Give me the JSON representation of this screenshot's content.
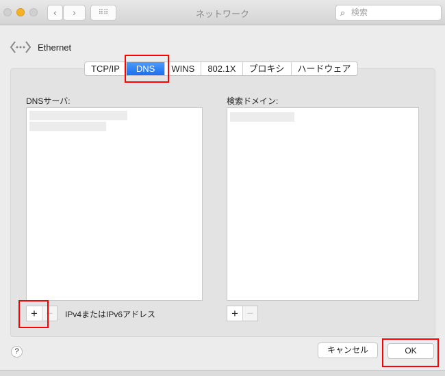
{
  "window": {
    "title": "ネットワーク",
    "search_placeholder": "検索"
  },
  "interface": {
    "name": "Ethernet",
    "icon": "ethernet-icon"
  },
  "tabs": [
    {
      "label": "TCP/IP"
    },
    {
      "label": "DNS",
      "active": true
    },
    {
      "label": "WINS"
    },
    {
      "label": "802.1X"
    },
    {
      "label": "プロキシ"
    },
    {
      "label": "ハードウェア"
    }
  ],
  "dns": {
    "label": "DNSサーバ:",
    "hint": "IPv4またはIPv6アドレス"
  },
  "search_domains": {
    "label": "検索ドメイン:"
  },
  "buttons": {
    "add": "+",
    "remove": "−",
    "cancel": "キャンセル",
    "ok": "OK",
    "help": "?"
  },
  "colors": {
    "accent": "#1a6ff0",
    "annotation": "#ff0000"
  }
}
